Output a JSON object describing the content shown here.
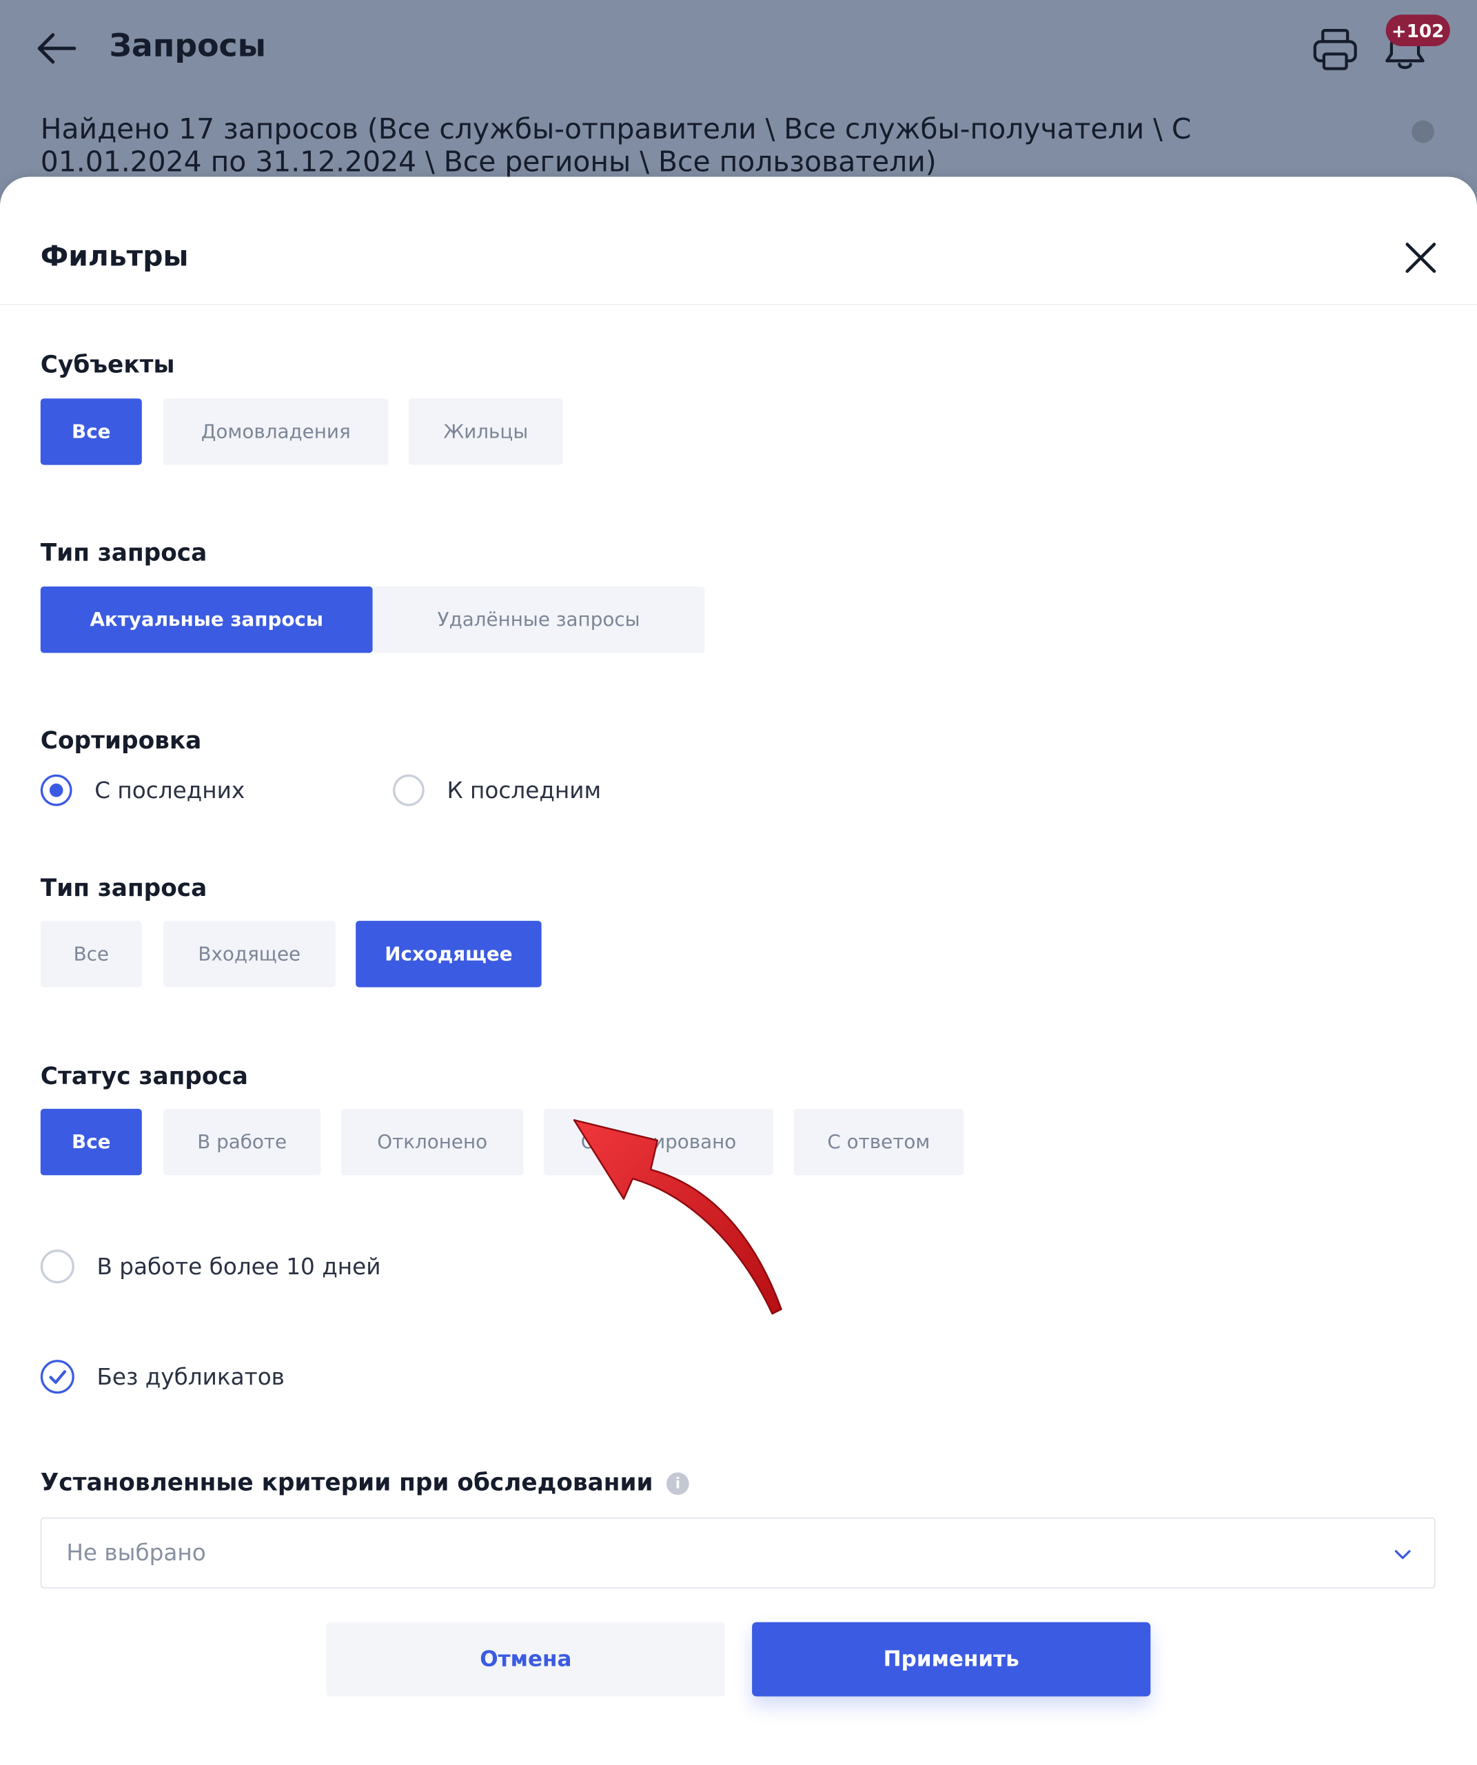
{
  "header": {
    "title": "Запросы",
    "notification_count": "+102",
    "found_text": "Найдено 17 запросов (Все службы-отправители \\ Все службы-получатели \\ С 01.01.2024 по 31.12.2024 \\ Все регионы \\ Все пользователи)",
    "icons": {
      "back": "arrow-left-icon",
      "print": "printer-icon",
      "notifications": "bell-icon",
      "info": "info-icon"
    }
  },
  "filters": {
    "title": "Фильтры",
    "subjects": {
      "label": "Субъекты",
      "options": [
        {
          "label": "Все",
          "active": true
        },
        {
          "label": "Домовладения",
          "active": false
        },
        {
          "label": "Жильцы",
          "active": false
        }
      ]
    },
    "request_type": {
      "label": "Тип запроса",
      "options": [
        {
          "label": "Актуальные запросы",
          "active": true
        },
        {
          "label": "Удалённые запросы",
          "active": false
        }
      ]
    },
    "sorting": {
      "label": "Сортировка",
      "options": [
        {
          "label": "С последних",
          "checked": true
        },
        {
          "label": "К последним",
          "checked": false
        }
      ]
    },
    "direction": {
      "label": "Тип запроса",
      "options": [
        {
          "label": "Все",
          "active": false
        },
        {
          "label": "Входящее",
          "active": false
        },
        {
          "label": "Исходящее",
          "active": true
        }
      ]
    },
    "status": {
      "label": "Статус запроса",
      "options": [
        {
          "label": "Все",
          "active": true
        },
        {
          "label": "В работе",
          "active": false
        },
        {
          "label": "Отклонено",
          "active": false
        },
        {
          "label": "Отреагировано",
          "active": false
        },
        {
          "label": "С ответом",
          "active": false
        }
      ]
    },
    "in_work_over_10_days": {
      "label": "В работе более 10 дней",
      "checked": false
    },
    "no_duplicates": {
      "label": "Без дубликатов",
      "checked": true
    },
    "criteria": {
      "label": "Установленные критерии при обследовании",
      "value": "Не выбрано"
    },
    "actions": {
      "cancel": "Отмена",
      "apply": "Применить"
    }
  },
  "colors": {
    "accent": "#3b5be2",
    "chip_bg": "#f2f4f9",
    "header_overlay": "#818da2",
    "badge": "#8d1f3f",
    "annotation_arrow": "#d4161b"
  }
}
